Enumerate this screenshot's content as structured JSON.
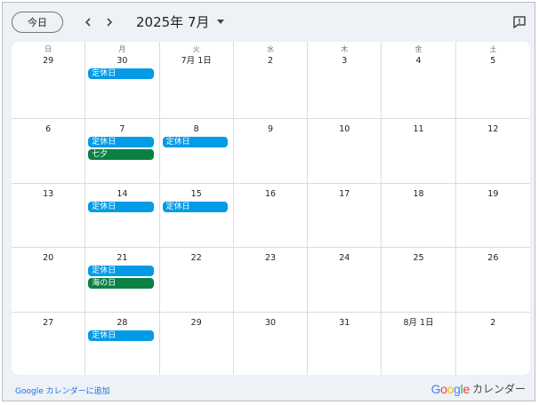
{
  "toolbar": {
    "today_label": "今日",
    "month_label": "2025年 7月"
  },
  "weekdays": [
    "日",
    "月",
    "火",
    "水",
    "木",
    "金",
    "土"
  ],
  "weeks": [
    {
      "days": [
        {
          "label": "29",
          "events": []
        },
        {
          "label": "30",
          "events": [
            {
              "title": "定休日",
              "color": "#039be5"
            }
          ]
        },
        {
          "label": "7月 1日",
          "events": []
        },
        {
          "label": "2",
          "events": []
        },
        {
          "label": "3",
          "events": []
        },
        {
          "label": "4",
          "events": []
        },
        {
          "label": "5",
          "events": []
        }
      ]
    },
    {
      "days": [
        {
          "label": "6",
          "events": []
        },
        {
          "label": "7",
          "events": [
            {
              "title": "定休日",
              "color": "#039be5"
            },
            {
              "title": "七夕",
              "color": "#0b8043"
            }
          ]
        },
        {
          "label": "8",
          "events": [
            {
              "title": "定休日",
              "color": "#039be5"
            }
          ]
        },
        {
          "label": "9",
          "events": []
        },
        {
          "label": "10",
          "events": []
        },
        {
          "label": "11",
          "events": []
        },
        {
          "label": "12",
          "events": []
        }
      ]
    },
    {
      "days": [
        {
          "label": "13",
          "events": []
        },
        {
          "label": "14",
          "events": [
            {
              "title": "定休日",
              "color": "#039be5"
            }
          ]
        },
        {
          "label": "15",
          "events": [
            {
              "title": "定休日",
              "color": "#039be5"
            }
          ]
        },
        {
          "label": "16",
          "events": []
        },
        {
          "label": "17",
          "events": []
        },
        {
          "label": "18",
          "events": []
        },
        {
          "label": "19",
          "events": []
        }
      ]
    },
    {
      "days": [
        {
          "label": "20",
          "events": []
        },
        {
          "label": "21",
          "events": [
            {
              "title": "定休日",
              "color": "#039be5"
            },
            {
              "title": "海の日",
              "color": "#0b8043"
            }
          ]
        },
        {
          "label": "22",
          "events": []
        },
        {
          "label": "23",
          "events": []
        },
        {
          "label": "24",
          "events": []
        },
        {
          "label": "25",
          "events": []
        },
        {
          "label": "26",
          "events": []
        }
      ]
    },
    {
      "days": [
        {
          "label": "27",
          "events": []
        },
        {
          "label": "28",
          "events": [
            {
              "title": "定休日",
              "color": "#039be5"
            }
          ]
        },
        {
          "label": "29",
          "events": []
        },
        {
          "label": "30",
          "events": []
        },
        {
          "label": "31",
          "events": []
        },
        {
          "label": "8月 1日",
          "events": []
        },
        {
          "label": "2",
          "events": []
        }
      ]
    }
  ],
  "footer": {
    "add_link": "Google カレンダーに追加",
    "brand_google": "Google",
    "brand_calendar": "カレンダー"
  },
  "colors": {
    "event_blue": "#039be5",
    "event_green": "#0b8043",
    "link": "#1a73e8"
  }
}
